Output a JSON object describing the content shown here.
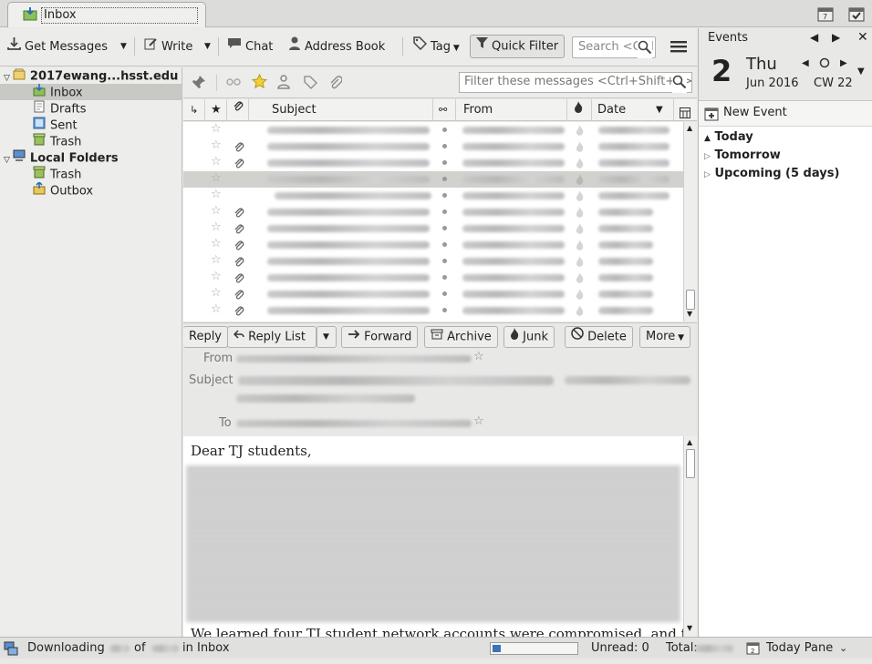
{
  "tab": {
    "title": "Inbox"
  },
  "toolbar": {
    "get_messages": "Get Messages",
    "write": "Write",
    "chat": "Chat",
    "address_book": "Address Book",
    "tag": "Tag",
    "quick_filter": "Quick Filter",
    "search_placeholder": "Search <Ctrl+K>"
  },
  "folders": {
    "account": "2017ewang...hsst.edu",
    "items": [
      "Inbox",
      "Drafts",
      "Sent",
      "Trash"
    ],
    "local": "Local Folders",
    "local_items": [
      "Trash",
      "Outbox"
    ]
  },
  "filter": {
    "placeholder": "Filter these messages <Ctrl+Shift+K>"
  },
  "columns": {
    "subject": "Subject",
    "from": "From",
    "date": "Date"
  },
  "message_rows": [
    {
      "attachment": false,
      "selected": false
    },
    {
      "attachment": true,
      "selected": false
    },
    {
      "attachment": true,
      "selected": false
    },
    {
      "attachment": false,
      "selected": true
    },
    {
      "attachment": false,
      "selected": false
    },
    {
      "attachment": true,
      "selected": false
    },
    {
      "attachment": true,
      "selected": false
    },
    {
      "attachment": true,
      "selected": false
    },
    {
      "attachment": true,
      "selected": false
    },
    {
      "attachment": true,
      "selected": false
    },
    {
      "attachment": true,
      "selected": false
    },
    {
      "attachment": true,
      "selected": false
    }
  ],
  "header_buttons": {
    "reply": "Reply",
    "reply_list": "Reply List",
    "forward": "Forward",
    "archive": "Archive",
    "junk": "Junk",
    "delete": "Delete",
    "more": "More"
  },
  "header_labels": {
    "from": "From",
    "subject": "Subject",
    "to": "To"
  },
  "body": {
    "greeting": "Dear TJ students,",
    "partial": "We learned four TJ student network accounts were compromised, and those students"
  },
  "today": {
    "title": "Events",
    "day_number": "2",
    "weekday": "Thu",
    "month_year": "Jun 2016",
    "week": "CW 22",
    "new_event": "New Event",
    "sections": [
      "Today",
      "Tomorrow",
      "Upcoming (5 days)"
    ]
  },
  "status": {
    "downloading": "Downloading",
    "of": "of",
    "in_inbox": "in Inbox",
    "unread": "Unread: 0",
    "total": "Total:",
    "today_pane": "Today Pane"
  }
}
